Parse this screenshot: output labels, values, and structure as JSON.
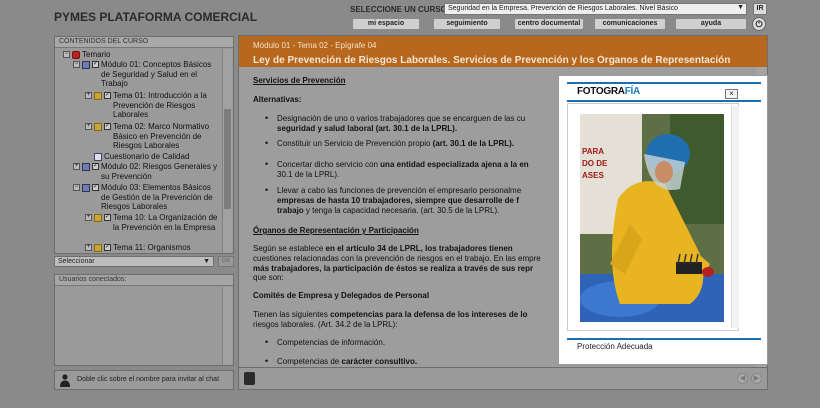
{
  "header": {
    "brand": "PYMES PLATAFORMA COMERCIAL",
    "course_label": "SELECCIONE UN CURSO:",
    "course_value": "Seguridad en la Empresa. Prevención de Riesgos Laborales. Nivel Básico",
    "ir_label": "IR",
    "nav": [
      "mi espacio",
      "seguimiento",
      "centro documental",
      "comunicaciones",
      "ayuda"
    ]
  },
  "sidebar": {
    "title": "CONTENIDOS DEL CURSO",
    "items": [
      "Temario",
      "Módulo 01: Conceptos Básicos de Seguridad y Salud en el Trabajo",
      "Tema 01: Introducción a la Prevención de Riesgos Laborales",
      "Tema 02: Marco Normativo Básico en Prevención de Riesgos Laborales",
      "Cuestionario de Calidad",
      "Módulo 02: Riesgos Generales y su Prevención",
      "Módulo 03: Elementos Básicos de Gestión de la Prevención de Riesgos Laborales",
      "Tema 10: La Organización de la Prevención en la Empresa",
      "Tema 11: Organismos"
    ],
    "select_label": "Seleccionar",
    "ok_label": "OK"
  },
  "users": {
    "title": "Usuarios conectados:",
    "hint": "Doble clic sobre el nombre para invitar al chat"
  },
  "content": {
    "breadcrumb": "Módulo 01 - Tema 02 - Epígrafe 04",
    "title": "Ley de Prevención de Riesgos Laborales. Servicios de Prevención y los Órganos de Representación",
    "h_servicios": "Servicios de Prevención",
    "h_alternativas": "Alternativas:",
    "b1_a": "Designación de uno o varios trabajadores que se encarguen de las cu",
    "b1_b": "seguridad y salud laboral (art. 30.1 de la LPRL).",
    "b2_a": "Constituir un Servicio de Prevención propio",
    "b2_b": "(art. 30.1 de la LPRL).",
    "b3_a": "Concertar dicho servicio con",
    "b3_b": "una entidad especializada ajena a la en",
    "b3_c": "30.1 de la LPRL).",
    "b4_a": "Llevar a cabo las funciones de prevención el empresario personalme",
    "b4_b": "empresas de hasta 10 trabajadores, siempre que desarrolle de f",
    "b4_c": "trabajo",
    "b4_d": "y tenga la capacidad necesaria. (art. 30.5 de la LPRL).",
    "h_organos": "Órganos de Representación y Participación",
    "p1_a": "Según se establece",
    "p1_b": "en el artículo 34 de LPRL, los trabajadores tienen",
    "p1_c": "cuestiones relacionadas con la prevención de riesgos en el trabajo. En las empre",
    "p1_d": "más trabajadores, la participación de éstos se realiza a través de sus repr",
    "p1_e": "que son:",
    "h_comites": "Comités de Empresa y Delegados de Personal",
    "p2_a": "Tienen las siguientes",
    "p2_b": "competencias para la defensa de los intereses de lo",
    "p2_c": "riesgos laborales. (Art. 34.2 de la LPRL):",
    "b5": "Competencias de información.",
    "b6_a": "Competencias de",
    "b6_b": "carácter consultivo."
  },
  "modal": {
    "logo_a": "FOTOGRA",
    "logo_b": "FÍA",
    "close": "×",
    "caption": "Protección Adecuada",
    "sign_lines": [
      "PARA",
      "DO DE",
      "ASES"
    ]
  }
}
